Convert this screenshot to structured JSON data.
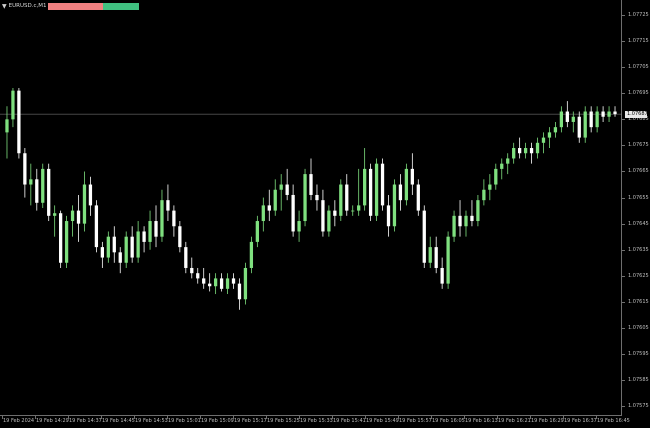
{
  "symbol": {
    "label": "EURUSD.c,M1",
    "arrow_icon": "triangle-down-icon",
    "sell_color": "#f08080",
    "buy_color": "#40c080"
  },
  "colors": {
    "background": "#000000",
    "candle_up": "#7fe07f",
    "candle_down": "#ffffff",
    "axis": "#6e6e6e",
    "axis_text": "#bdbdbd",
    "bid_line": "#8a8a8a"
  },
  "price_axis": {
    "ticks": [
      "1.07725",
      "1.07715",
      "1.07705",
      "1.07695",
      "1.07685",
      "1.07675",
      "1.07665",
      "1.07655",
      "1.07645",
      "1.07635",
      "1.07625",
      "1.07615",
      "1.07605",
      "1.07595",
      "1.07585",
      "1.07575"
    ],
    "bid_label": "1.07687"
  },
  "time_axis": {
    "ticks": [
      "19 Feb 2024",
      "19 Feb 14:29",
      "19 Feb 14:37",
      "19 Feb 14:45",
      "19 Feb 14:53",
      "19 Feb 15:01",
      "19 Feb 15:09",
      "19 Feb 15:17",
      "19 Feb 15:25",
      "19 Feb 15:33",
      "19 Feb 15:41",
      "19 Feb 15:49",
      "19 Feb 15:57",
      "19 Feb 16:05",
      "19 Feb 16:13",
      "19 Feb 16:21",
      "19 Feb 16:29",
      "19 Feb 16:37",
      "19 Feb 16:45"
    ]
  },
  "chart_data": {
    "type": "candlestick",
    "symbol": "EURUSD.c",
    "timeframe": "M1",
    "ylim": [
      1.07572,
      1.0773
    ],
    "bid": 1.07687,
    "candles": [
      [
        1.0768,
        1.0769,
        1.0767,
        1.07685
      ],
      [
        1.07685,
        1.07697,
        1.07682,
        1.07696
      ],
      [
        1.07696,
        1.07697,
        1.0767,
        1.07672
      ],
      [
        1.07672,
        1.07674,
        1.07655,
        1.0766
      ],
      [
        1.0766,
        1.07668,
        1.07652,
        1.07662
      ],
      [
        1.07662,
        1.07666,
        1.0765,
        1.07653
      ],
      [
        1.07653,
        1.07668,
        1.07651,
        1.07666
      ],
      [
        1.07666,
        1.07668,
        1.07646,
        1.07648
      ],
      [
        1.07648,
        1.07652,
        1.0764,
        1.07649
      ],
      [
        1.07649,
        1.0765,
        1.07628,
        1.0763
      ],
      [
        1.0763,
        1.07648,
        1.07628,
        1.07646
      ],
      [
        1.07646,
        1.07652,
        1.0764,
        1.0765
      ],
      [
        1.0765,
        1.07656,
        1.07638,
        1.07645
      ],
      [
        1.07645,
        1.07665,
        1.07642,
        1.0766
      ],
      [
        1.0766,
        1.07663,
        1.07648,
        1.07652
      ],
      [
        1.07652,
        1.07654,
        1.07634,
        1.07636
      ],
      [
        1.07636,
        1.07638,
        1.07628,
        1.07632
      ],
      [
        1.07632,
        1.07642,
        1.0763,
        1.0764
      ],
      [
        1.0764,
        1.07644,
        1.0763,
        1.07634
      ],
      [
        1.07634,
        1.07636,
        1.07626,
        1.0763
      ],
      [
        1.0763,
        1.07642,
        1.07628,
        1.0764
      ],
      [
        1.0764,
        1.07644,
        1.0763,
        1.07632
      ],
      [
        1.07632,
        1.07646,
        1.0763,
        1.07642
      ],
      [
        1.07642,
        1.07644,
        1.07634,
        1.07638
      ],
      [
        1.07638,
        1.0765,
        1.07635,
        1.07646
      ],
      [
        1.07646,
        1.07652,
        1.07636,
        1.0764
      ],
      [
        1.0764,
        1.07658,
        1.07638,
        1.07654
      ],
      [
        1.07654,
        1.0766,
        1.07646,
        1.0765
      ],
      [
        1.0765,
        1.07652,
        1.0764,
        1.07644
      ],
      [
        1.07644,
        1.07646,
        1.07634,
        1.07636
      ],
      [
        1.07636,
        1.07638,
        1.07626,
        1.07628
      ],
      [
        1.07628,
        1.07632,
        1.07624,
        1.07626
      ],
      [
        1.07626,
        1.07628,
        1.07622,
        1.07624
      ],
      [
        1.07624,
        1.07628,
        1.0762,
        1.07622
      ],
      [
        1.07622,
        1.07626,
        1.07619,
        1.07621
      ],
      [
        1.07621,
        1.07626,
        1.07618,
        1.07624
      ],
      [
        1.07624,
        1.07626,
        1.07619,
        1.0762
      ],
      [
        1.0762,
        1.07626,
        1.07618,
        1.07624
      ],
      [
        1.07624,
        1.07626,
        1.0762,
        1.07622
      ],
      [
        1.07622,
        1.07624,
        1.07612,
        1.07616
      ],
      [
        1.07616,
        1.0763,
        1.07614,
        1.07628
      ],
      [
        1.07628,
        1.0764,
        1.07626,
        1.07638
      ],
      [
        1.07638,
        1.07648,
        1.07636,
        1.07646
      ],
      [
        1.07646,
        1.07655,
        1.07642,
        1.07652
      ],
      [
        1.07652,
        1.07658,
        1.07646,
        1.0765
      ],
      [
        1.0765,
        1.07662,
        1.07648,
        1.07658
      ],
      [
        1.07658,
        1.07664,
        1.0765,
        1.0766
      ],
      [
        1.0766,
        1.07666,
        1.07654,
        1.07656
      ],
      [
        1.07656,
        1.0766,
        1.0764,
        1.07642
      ],
      [
        1.07642,
        1.0765,
        1.07638,
        1.07646
      ],
      [
        1.07646,
        1.07666,
        1.07644,
        1.07664
      ],
      [
        1.07664,
        1.0767,
        1.07654,
        1.07656
      ],
      [
        1.07656,
        1.0766,
        1.0765,
        1.07654
      ],
      [
        1.07654,
        1.07658,
        1.0764,
        1.07642
      ],
      [
        1.07642,
        1.07652,
        1.0764,
        1.0765
      ],
      [
        1.0765,
        1.07654,
        1.07644,
        1.07648
      ],
      [
        1.07648,
        1.07662,
        1.07646,
        1.0766
      ],
      [
        1.0766,
        1.07664,
        1.07648,
        1.0765
      ],
      [
        1.0765,
        1.07652,
        1.07648,
        1.0765
      ],
      [
        1.0765,
        1.07666,
        1.07648,
        1.07652
      ],
      [
        1.07652,
        1.07674,
        1.0765,
        1.07666
      ],
      [
        1.07666,
        1.07668,
        1.07646,
        1.07648
      ],
      [
        1.07648,
        1.0767,
        1.07646,
        1.07668
      ],
      [
        1.07668,
        1.0767,
        1.0765,
        1.07652
      ],
      [
        1.07652,
        1.07656,
        1.0764,
        1.07644
      ],
      [
        1.07644,
        1.07662,
        1.07642,
        1.0766
      ],
      [
        1.0766,
        1.07664,
        1.0765,
        1.07654
      ],
      [
        1.07654,
        1.07668,
        1.07652,
        1.07666
      ],
      [
        1.07666,
        1.07672,
        1.07656,
        1.0766
      ],
      [
        1.0766,
        1.07662,
        1.07648,
        1.0765
      ],
      [
        1.0765,
        1.07652,
        1.07628,
        1.0763
      ],
      [
        1.0763,
        1.0764,
        1.07628,
        1.07636
      ],
      [
        1.07636,
        1.0764,
        1.07626,
        1.07628
      ],
      [
        1.07628,
        1.07632,
        1.0762,
        1.07622
      ],
      [
        1.07622,
        1.07642,
        1.0762,
        1.0764
      ],
      [
        1.0764,
        1.0765,
        1.07638,
        1.07648
      ],
      [
        1.07648,
        1.07654,
        1.0764,
        1.07644
      ],
      [
        1.07644,
        1.0765,
        1.0764,
        1.07648
      ],
      [
        1.07648,
        1.07654,
        1.07644,
        1.07646
      ],
      [
        1.07646,
        1.07656,
        1.07644,
        1.07654
      ],
      [
        1.07654,
        1.07662,
        1.07652,
        1.07658
      ],
      [
        1.07658,
        1.07664,
        1.07654,
        1.0766
      ],
      [
        1.0766,
        1.07668,
        1.07658,
        1.07666
      ],
      [
        1.07666,
        1.0767,
        1.07662,
        1.07668
      ],
      [
        1.07668,
        1.07672,
        1.07664,
        1.0767
      ],
      [
        1.0767,
        1.07676,
        1.07668,
        1.07674
      ],
      [
        1.07674,
        1.07678,
        1.0767,
        1.07672
      ],
      [
        1.07672,
        1.07676,
        1.0767,
        1.07674
      ],
      [
        1.07674,
        1.07676,
        1.07668,
        1.07672
      ],
      [
        1.07672,
        1.07678,
        1.0767,
        1.07676
      ],
      [
        1.07676,
        1.0768,
        1.07672,
        1.07678
      ],
      [
        1.07678,
        1.07682,
        1.07674,
        1.0768
      ],
      [
        1.0768,
        1.07684,
        1.07678,
        1.07682
      ],
      [
        1.07682,
        1.0769,
        1.0768,
        1.07688
      ],
      [
        1.07688,
        1.07692,
        1.07682,
        1.07684
      ],
      [
        1.07684,
        1.07688,
        1.0768,
        1.07686
      ],
      [
        1.07686,
        1.07688,
        1.07676,
        1.07678
      ],
      [
        1.07678,
        1.0769,
        1.07676,
        1.07688
      ],
      [
        1.07688,
        1.0769,
        1.0768,
        1.07682
      ],
      [
        1.07682,
        1.0769,
        1.0768,
        1.07688
      ],
      [
        1.07688,
        1.0769,
        1.07684,
        1.07686
      ],
      [
        1.07686,
        1.0769,
        1.07684,
        1.07688
      ],
      [
        1.07688,
        1.0769,
        1.07686,
        1.07687
      ]
    ]
  }
}
